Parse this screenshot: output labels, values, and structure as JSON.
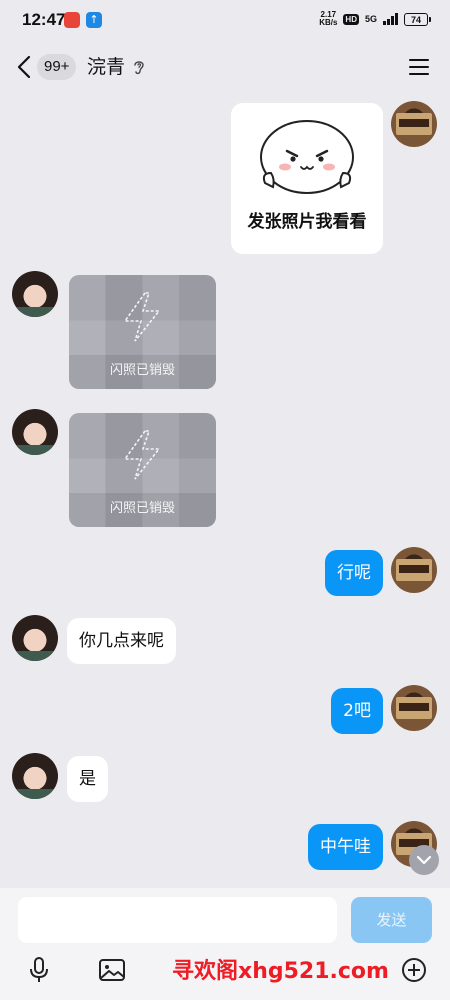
{
  "status_bar": {
    "time": "12:47",
    "net_speed_value": "2.17",
    "net_speed_unit": "KB/s",
    "hd": "HD",
    "network": "5G",
    "battery": "74"
  },
  "header": {
    "unread_count": "99+",
    "contact_name": "浣青",
    "back_icon": "chevron-left-icon",
    "ear_icon": "ear-icon",
    "menu_icon": "hamburger-menu-icon"
  },
  "messages": [
    {
      "side": "out",
      "type": "sticker",
      "text": "发张照片我看看"
    },
    {
      "side": "in",
      "type": "flash_photo",
      "text": "闪照已销毁"
    },
    {
      "side": "in",
      "type": "flash_photo",
      "text": "闪照已销毁"
    },
    {
      "side": "out",
      "type": "text",
      "text": "行呢"
    },
    {
      "side": "in",
      "type": "text",
      "text": "你几点来呢"
    },
    {
      "side": "out",
      "type": "text",
      "text": "2吧"
    },
    {
      "side": "in",
      "type": "text",
      "text": "是"
    },
    {
      "side": "out",
      "type": "text",
      "text": "中午哇"
    }
  ],
  "composer": {
    "placeholder": "",
    "send_label": "发送"
  },
  "toolbar": [
    "microphone-icon",
    "image-icon",
    "plus-circle-icon"
  ],
  "watermark": "寻欢阁xhg521.com",
  "colors": {
    "background": "#ebebef",
    "outgoing_bubble": "#0a96f6",
    "incoming_bubble": "#ffffff",
    "send_button_disabled": "#89c6f4",
    "watermark": "#ee1c24"
  }
}
